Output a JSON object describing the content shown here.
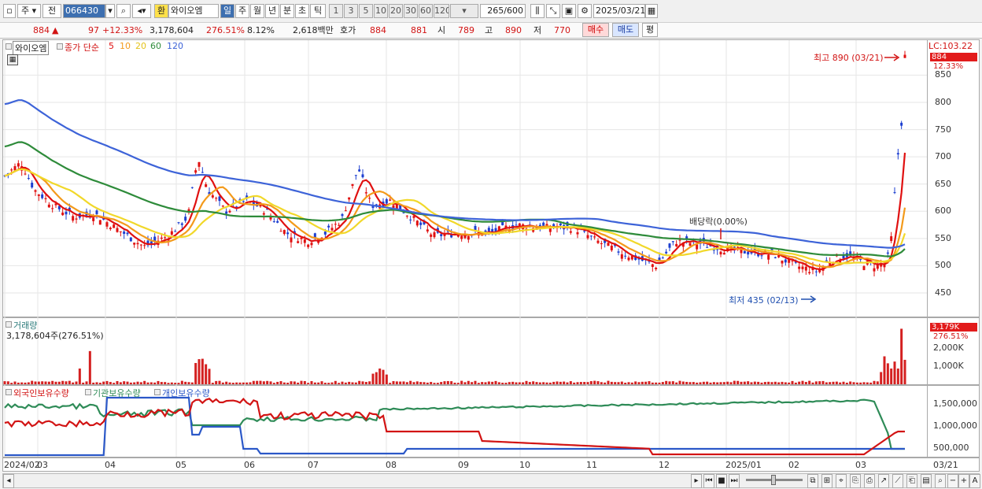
{
  "toolbar": {
    "market": "주",
    "prev": "전",
    "code": "066430",
    "name_btn": "환",
    "stock_name": "와이오엠",
    "periods": [
      "일",
      "주",
      "월",
      "년",
      "분",
      "초",
      "틱"
    ],
    "intervals": [
      "1",
      "3",
      "5",
      "10",
      "20",
      "30",
      "60",
      "120"
    ],
    "count": "265",
    "count_total": "/600",
    "date": "2025/03/21"
  },
  "quote": {
    "price": "884",
    "arrow": "▲",
    "change": "97",
    "change_pct": "+12.33%",
    "volume": "3,178,604",
    "vol_ratio": "276.51%",
    "turnover": "8.12%",
    "amount": "2,618백만",
    "hoga_label": "호가",
    "ask": "884",
    "bid": "881",
    "open_label": "시",
    "open": "789",
    "high_label": "고",
    "high": "890",
    "low_label": "저",
    "low": "770",
    "buy": "매수",
    "sell": "매도",
    "avg": "평"
  },
  "price_chart": {
    "stock_label": "와이오엠",
    "ma_title": "종가 단순",
    "ma_periods": [
      "5",
      "10",
      "20",
      "60",
      "120"
    ],
    "lc_label": "LC:103.22",
    "cur_price_tag": "884",
    "cur_pct_tag": "12.33%",
    "high_note": "최고 890 (03/21)",
    "low_note": "최저 435 (02/13)",
    "dividend_note": "배당락(0.00%)",
    "y_ticks": [
      "850",
      "800",
      "750",
      "700",
      "650",
      "600",
      "550",
      "500",
      "450"
    ]
  },
  "volume_chart": {
    "title": "거래량",
    "info": "3,178,604주(276.51%)",
    "tag_value": "3,179K",
    "tag_pct": "276.51%",
    "y_ticks": [
      "2,000K",
      "1,000K"
    ]
  },
  "holding_chart": {
    "legend": [
      "외국인보유수량",
      "기관보유수량",
      "개인보유수량"
    ],
    "y_ticks": [
      "1,500,000",
      "1,000,000",
      "500,000"
    ]
  },
  "x_labels": [
    "2024/02",
    "03",
    "04",
    "05",
    "06",
    "07",
    "08",
    "09",
    "10",
    "11",
    "12",
    "2025/01",
    "02",
    "03"
  ],
  "x_right": "03/21",
  "colors": {
    "up": "#e01010",
    "down": "#1d3fd0",
    "ma5": "#e01010",
    "ma10": "#f39a1b",
    "ma20": "#f1d82a",
    "ma60": "#2e8b3a",
    "ma120": "#3d63d8"
  }
}
